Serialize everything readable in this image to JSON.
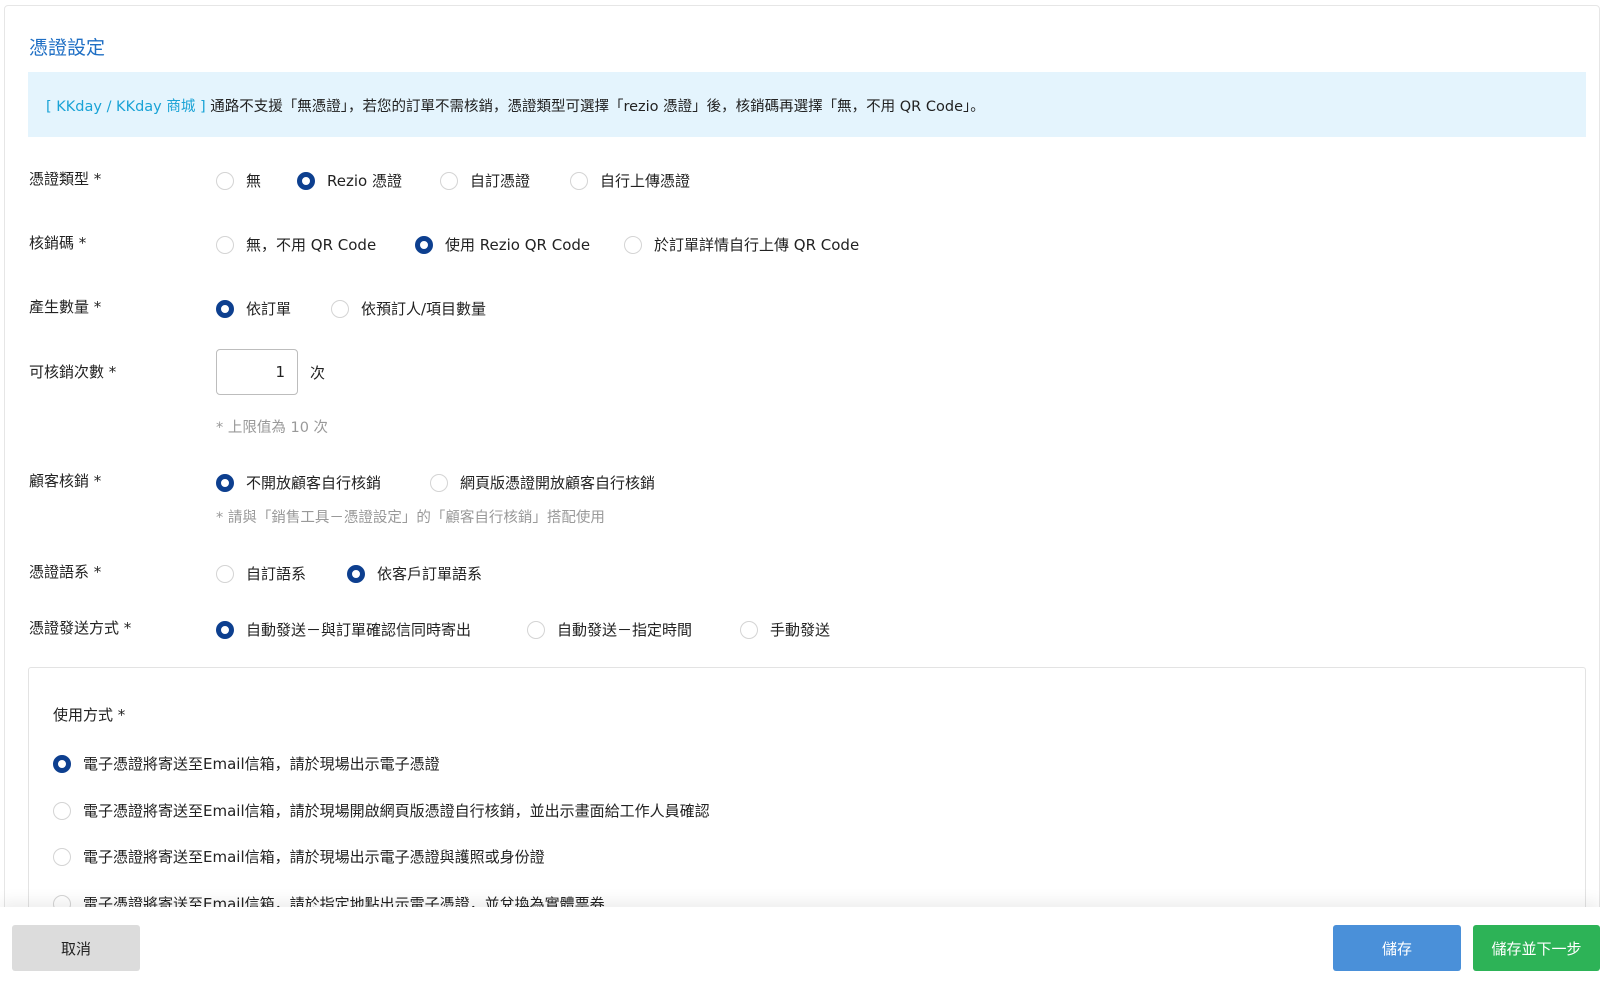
{
  "section_title": "憑證設定",
  "notice": {
    "tag": "[ KKday / KKday 商城 ]",
    "text": " 通路不支援「無憑證」，若您的訂單不需核銷，憑證類型可選擇「rezio 憑證」後，核銷碼再選擇「無，不用 QR Code」。"
  },
  "voucher_type": {
    "label": "憑證類型 *",
    "options": [
      "無",
      "Rezio 憑證",
      "自訂憑證",
      "自行上傳憑證"
    ],
    "selected": "Rezio 憑證"
  },
  "redemption_code": {
    "label": "核銷碼 *",
    "options": [
      "無，不用 QR Code",
      "使用 Rezio QR Code",
      "於訂單詳情自行上傳 QR Code"
    ],
    "selected": "使用 Rezio QR Code"
  },
  "quantity": {
    "label": "產生數量 *",
    "options": [
      "依訂單",
      "依預訂人/項目數量"
    ],
    "selected": "依訂單"
  },
  "redeem_times": {
    "label": "可核銷次數 *",
    "value": "1",
    "unit": "次",
    "hint": "* 上限值為 10 次"
  },
  "customer_redeem": {
    "label": "顧客核銷 *",
    "options": [
      "不開放顧客自行核銷",
      "網頁版憑證開放顧客自行核銷"
    ],
    "selected": "不開放顧客自行核銷",
    "hint": "* 請與「銷售工具－憑證設定」的「顧客自行核銷」搭配使用"
  },
  "voucher_language": {
    "label": "憑證語系 *",
    "options": [
      "自訂語系",
      "依客戶訂單語系"
    ],
    "selected": "依客戶訂單語系"
  },
  "send_method": {
    "label": "憑證發送方式 *",
    "options": [
      "自動發送－與訂單確認信同時寄出",
      "自動發送－指定時間",
      "手動發送"
    ],
    "selected": "自動發送－與訂單確認信同時寄出"
  },
  "usage": {
    "label": "使用方式 *",
    "options": [
      "電子憑證將寄送至Email信箱，請於現場出示電子憑證",
      "電子憑證將寄送至Email信箱，請於現場開啟網頁版憑證自行核銷，並出示畫面給工作人員確認",
      "電子憑證將寄送至Email信箱，請於現場出示電子憑證與護照或身份證",
      "電子憑證將寄送至Email信箱，請於指定地點出示電子憑證，並兌換為實體票券"
    ],
    "selected": "電子憑證將寄送至Email信箱，請於現場出示電子憑證"
  },
  "footer": {
    "cancel": "取消",
    "save": "儲存",
    "save_next": "儲存並下一步"
  },
  "colors": {
    "accent_blue": "#1f6fc4",
    "radio_selected": "#0d3f8f",
    "notice_bg": "#e4f4fd",
    "notice_tag": "#1aa3d6",
    "save_button": "#4a90d9",
    "save_next_button": "#2db357"
  }
}
